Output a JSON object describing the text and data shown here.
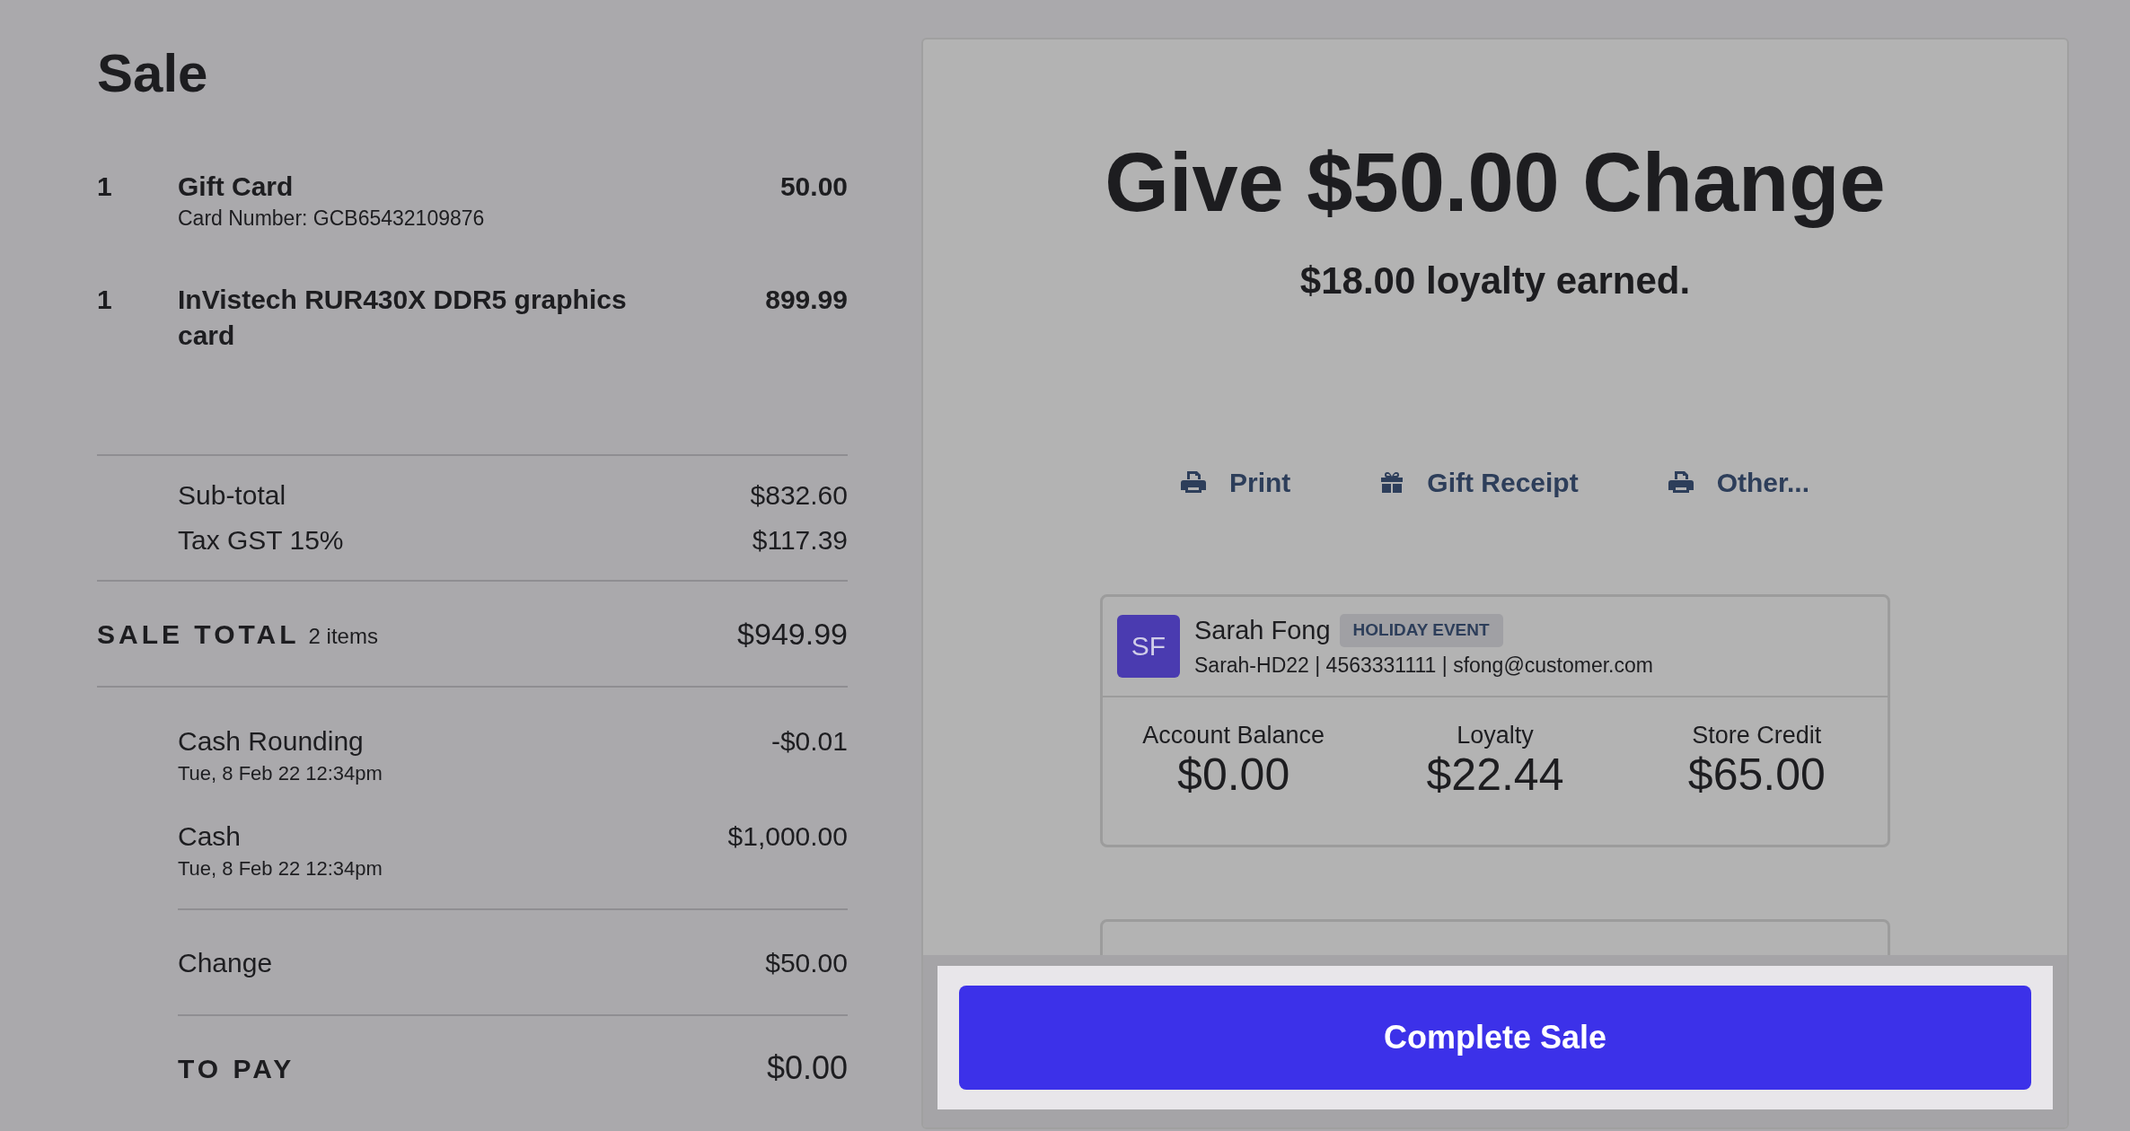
{
  "title": "Sale",
  "line_items": [
    {
      "qty": "1",
      "name": "Gift Card",
      "detail": "Card Number: GCB65432109876",
      "price": "50.00"
    },
    {
      "qty": "1",
      "name": "InVistech RUR430X DDR5 graphics card",
      "price": "899.99"
    }
  ],
  "totals": [
    {
      "label": "Sub-total",
      "value": "$832.60"
    },
    {
      "label": "Tax GST 15%",
      "value": "$117.39"
    }
  ],
  "sale_total": {
    "label": "SALE TOTAL",
    "count": "2 items",
    "value": "$949.99"
  },
  "payments": [
    {
      "label": "Cash Rounding",
      "date": "Tue, 8 Feb 22 12:34pm",
      "value": "-$0.01"
    },
    {
      "label": "Cash",
      "date": "Tue, 8 Feb 22 12:34pm",
      "value": "$1,000.00"
    }
  ],
  "change": {
    "label": "Change",
    "value": "$50.00"
  },
  "to_pay": {
    "label": "TO PAY",
    "value": "$0.00"
  },
  "headline": "Give $50.00 Change",
  "loyalty_note": "$18.00 loyalty earned.",
  "actions": [
    {
      "kind": "print",
      "label": "Print"
    },
    {
      "kind": "gift",
      "label": "Gift Receipt"
    },
    {
      "kind": "print",
      "label": "Other..."
    }
  ],
  "customer": {
    "initials": "SF",
    "name": "Sarah Fong",
    "tag": "HOLIDAY EVENT",
    "details": "Sarah-HD22 | 4563331111 | sfong@customer.com",
    "stats": [
      {
        "label": "Account Balance",
        "value": "$0.00"
      },
      {
        "label": "Loyalty",
        "value": "$22.44"
      },
      {
        "label": "Store Credit",
        "value": "$65.00"
      }
    ]
  },
  "complete_button": "Complete Sale"
}
